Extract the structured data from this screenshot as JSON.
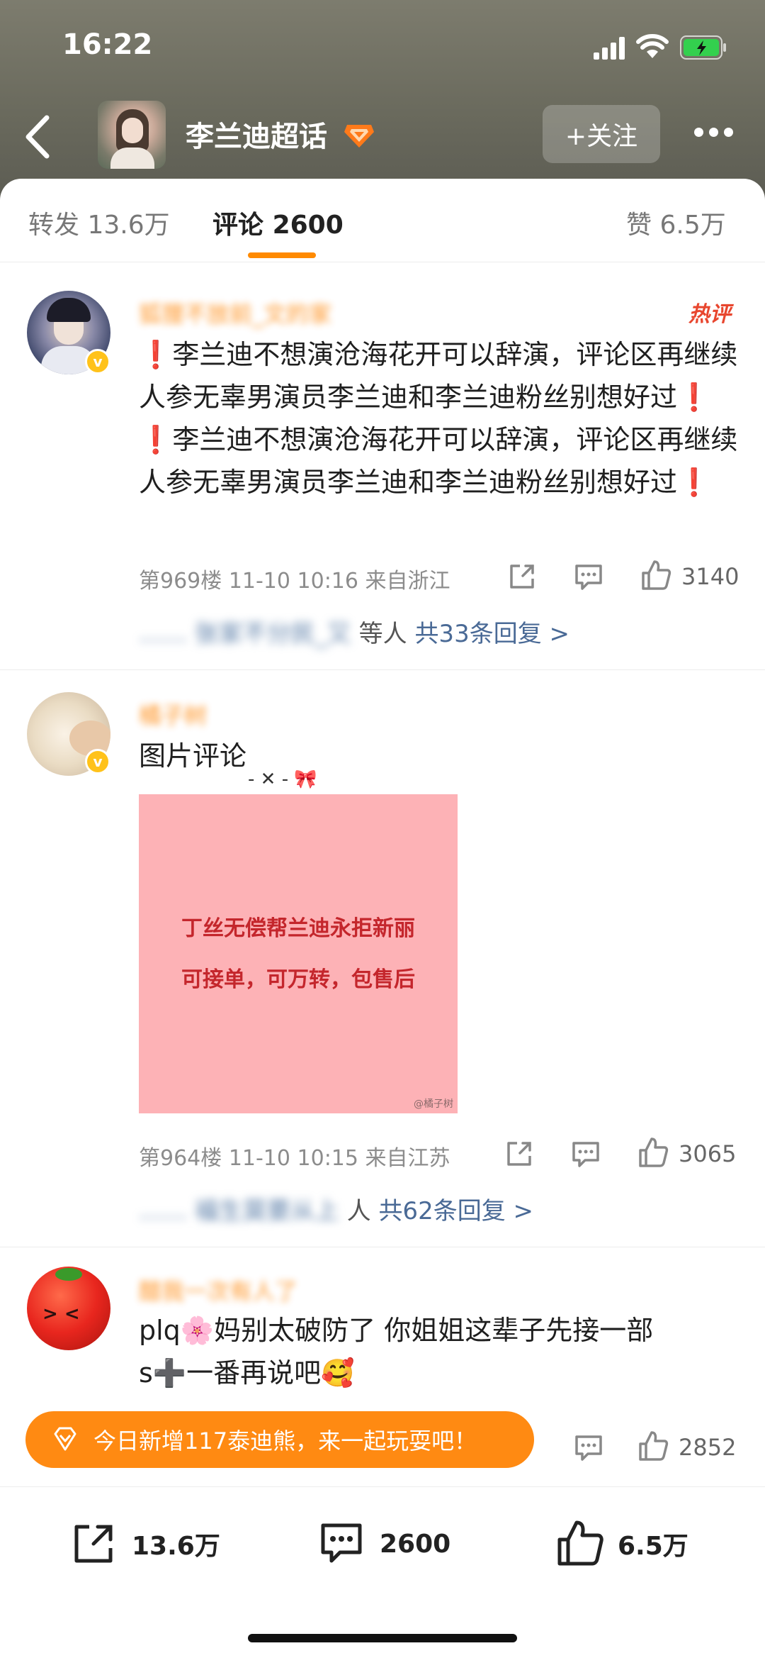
{
  "status": {
    "time": "16:22"
  },
  "header": {
    "title": "李兰迪超话",
    "follow_label": "+关注"
  },
  "tabs": [
    {
      "label": "转发",
      "count": "13.6万"
    },
    {
      "label": "评论",
      "count": "2600"
    },
    {
      "label": "赞",
      "count": "6.5万"
    }
  ],
  "comments": [
    {
      "username": "狐狸不放前_文的家",
      "hot_label": "热评",
      "text": "❗李兰迪不想演沧海花开可以辞演，评论区再继续人参无辜男演员李兰迪和李兰迪粉丝别想好过❗ ❗李兰迪不想演沧海花开可以辞演，评论区再继续人参无辜男演员李兰迪和李兰迪粉丝别想好过❗",
      "floor": "第969楼",
      "datetime": "11-10 10:16",
      "location": "来自浙江",
      "likes": "3140",
      "reply_names": "……  张家不分民_又",
      "reply_suffix": "等人",
      "reply_link": "共33条回复 >"
    },
    {
      "username": "橘子树",
      "text": "图片评论",
      "image_lines": [
        "丁丝无偿帮兰迪永拒新丽",
        "可接单，可万转，包售后"
      ],
      "image_watermark": "@橘子树",
      "floor": "第964楼",
      "datetime": "11-10 10:15",
      "location": "来自江苏",
      "likes": "3065",
      "reply_names": "……  福生莫要从上",
      "reply_suffix": "人",
      "reply_link": "共62条回复 >"
    },
    {
      "username": "醋我一次有人了",
      "text_line1": "plq🌸妈别太破防了 你姐姐这辈子先接一部",
      "text_line2": "s➕一番再说吧🥰",
      "likes": "2852"
    }
  ],
  "banner": {
    "text": "今日新增117泰迪熊，来一起玩耍吧！"
  },
  "bottom_bar": {
    "repost": "13.6万",
    "comment": "2600",
    "like": "6.5万"
  }
}
